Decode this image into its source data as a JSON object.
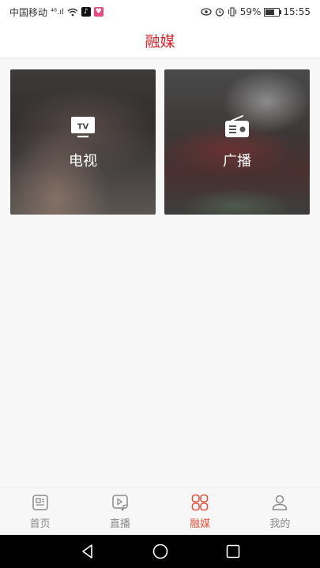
{
  "status_bar": {
    "carrier": "中国移动",
    "signal": "⁴⁶.ıl",
    "wifi": "wifi-icon",
    "battery_percent": "59%",
    "time": "15:55"
  },
  "header": {
    "title": "融媒"
  },
  "cards": [
    {
      "label": "电视",
      "icon": "tv-icon",
      "icon_text": "TV"
    },
    {
      "label": "广播",
      "icon": "radio-icon"
    }
  ],
  "nav": {
    "items": [
      {
        "label": "首页",
        "icon": "newspaper-icon",
        "active": false
      },
      {
        "label": "直播",
        "icon": "live-video-icon",
        "active": false
      },
      {
        "label": "融媒",
        "icon": "grid-icon",
        "active": true
      },
      {
        "label": "我的",
        "icon": "user-icon",
        "active": false
      }
    ]
  },
  "colors": {
    "accent": "#d8282b",
    "nav_active": "#e2553f",
    "nav_inactive": "#8a8a8a"
  }
}
